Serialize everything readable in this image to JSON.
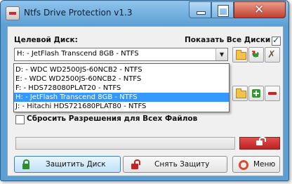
{
  "window": {
    "title": "Ntfs Drive Protection v1.3"
  },
  "target_disk": {
    "label": "Целевой Диск:",
    "show_all_label": "Показать Все Диски",
    "show_all_checked": true,
    "selected": "H: - JetFlash Transcend 8GB - NTFS",
    "options": [
      "D: - WDC WD2500JS-60NCB2 - NTFS",
      "E: - WDC WD2500JS-60NCB2 - NTFS",
      "F: - HDS728080PLAT20 - NTFS",
      "H: - JetFlash Transcend 8GB - NTFS",
      "J: - Hitachi HDS721680PLAT80 - NTFS"
    ],
    "highlighted_index": 3
  },
  "reset_permissions": {
    "label": "Сбросить Разрешения для Всех Файлов",
    "checked": false
  },
  "progress": {
    "value": 0
  },
  "buttons": {
    "protect": "Защитить Диск",
    "unprotect": "Снять Защиту",
    "menu": "Меню"
  },
  "icons": {
    "app": "app-disk-icon",
    "folder": "folder-icon",
    "sync": "sync-icon",
    "tools": "tools-icon",
    "add": "plus-icon",
    "remove": "minus-icon",
    "unlock": "unlock-icon",
    "lock": "lock-icon",
    "menu": "lifebuoy-icon"
  },
  "colors": {
    "titlebar": "#5d9fd3",
    "close": "#c2402c",
    "selection": "#3399ff",
    "unlock_button": "#c21f1f"
  }
}
